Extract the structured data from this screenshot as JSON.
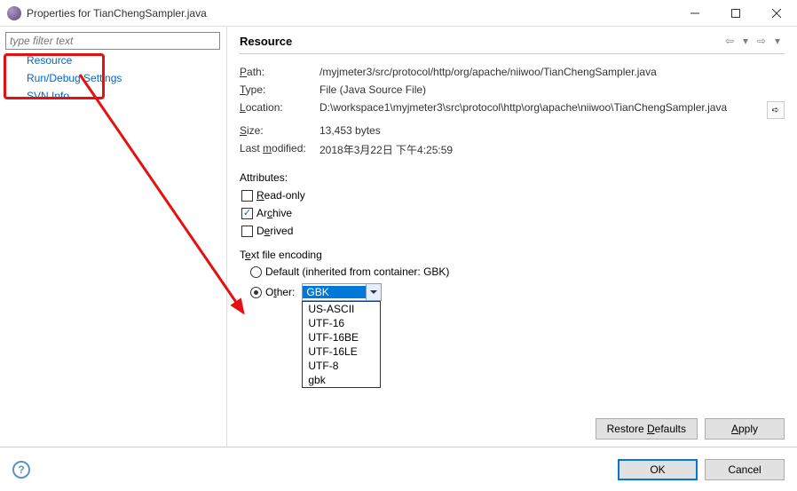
{
  "window": {
    "title": "Properties for TianChengSampler.java"
  },
  "sidebar": {
    "filter_placeholder": "type filter text",
    "items": [
      {
        "label": "Resource"
      },
      {
        "label": "Run/Debug Settings"
      },
      {
        "label": "SVN Info"
      }
    ]
  },
  "main": {
    "title": "Resource",
    "info": {
      "path_label": "Path:",
      "path_value": "/myjmeter3/src/protocol/http/org/apache/niiwoo/TianChengSampler.java",
      "type_label": "Type:",
      "type_value": "File  (Java Source File)",
      "location_label": "Location:",
      "location_value": "D:\\workspace1\\myjmeter3\\src\\protocol\\http\\org\\apache\\niiwoo\\TianChengSampler.java",
      "size_label": "Size:",
      "size_value": "13,453  bytes",
      "modified_label": "Last modified:",
      "modified_value": "2018年3月22日 下午4:25:59"
    },
    "attributes": {
      "label": "Attributes:",
      "readonly": "Read-only",
      "archive": "Archive",
      "derived": "Derived"
    },
    "encoding": {
      "group_label": "Text file encoding",
      "default_label": "Default (inherited from container: GBK)",
      "other_label": "Other:",
      "selected": "GBK",
      "options": [
        "US-ASCII",
        "UTF-16",
        "UTF-16BE",
        "UTF-16LE",
        "UTF-8",
        "gbk"
      ]
    },
    "buttons": {
      "restore": "Restore Defaults",
      "apply": "Apply"
    }
  },
  "footer": {
    "ok": "OK",
    "cancel": "Cancel"
  }
}
